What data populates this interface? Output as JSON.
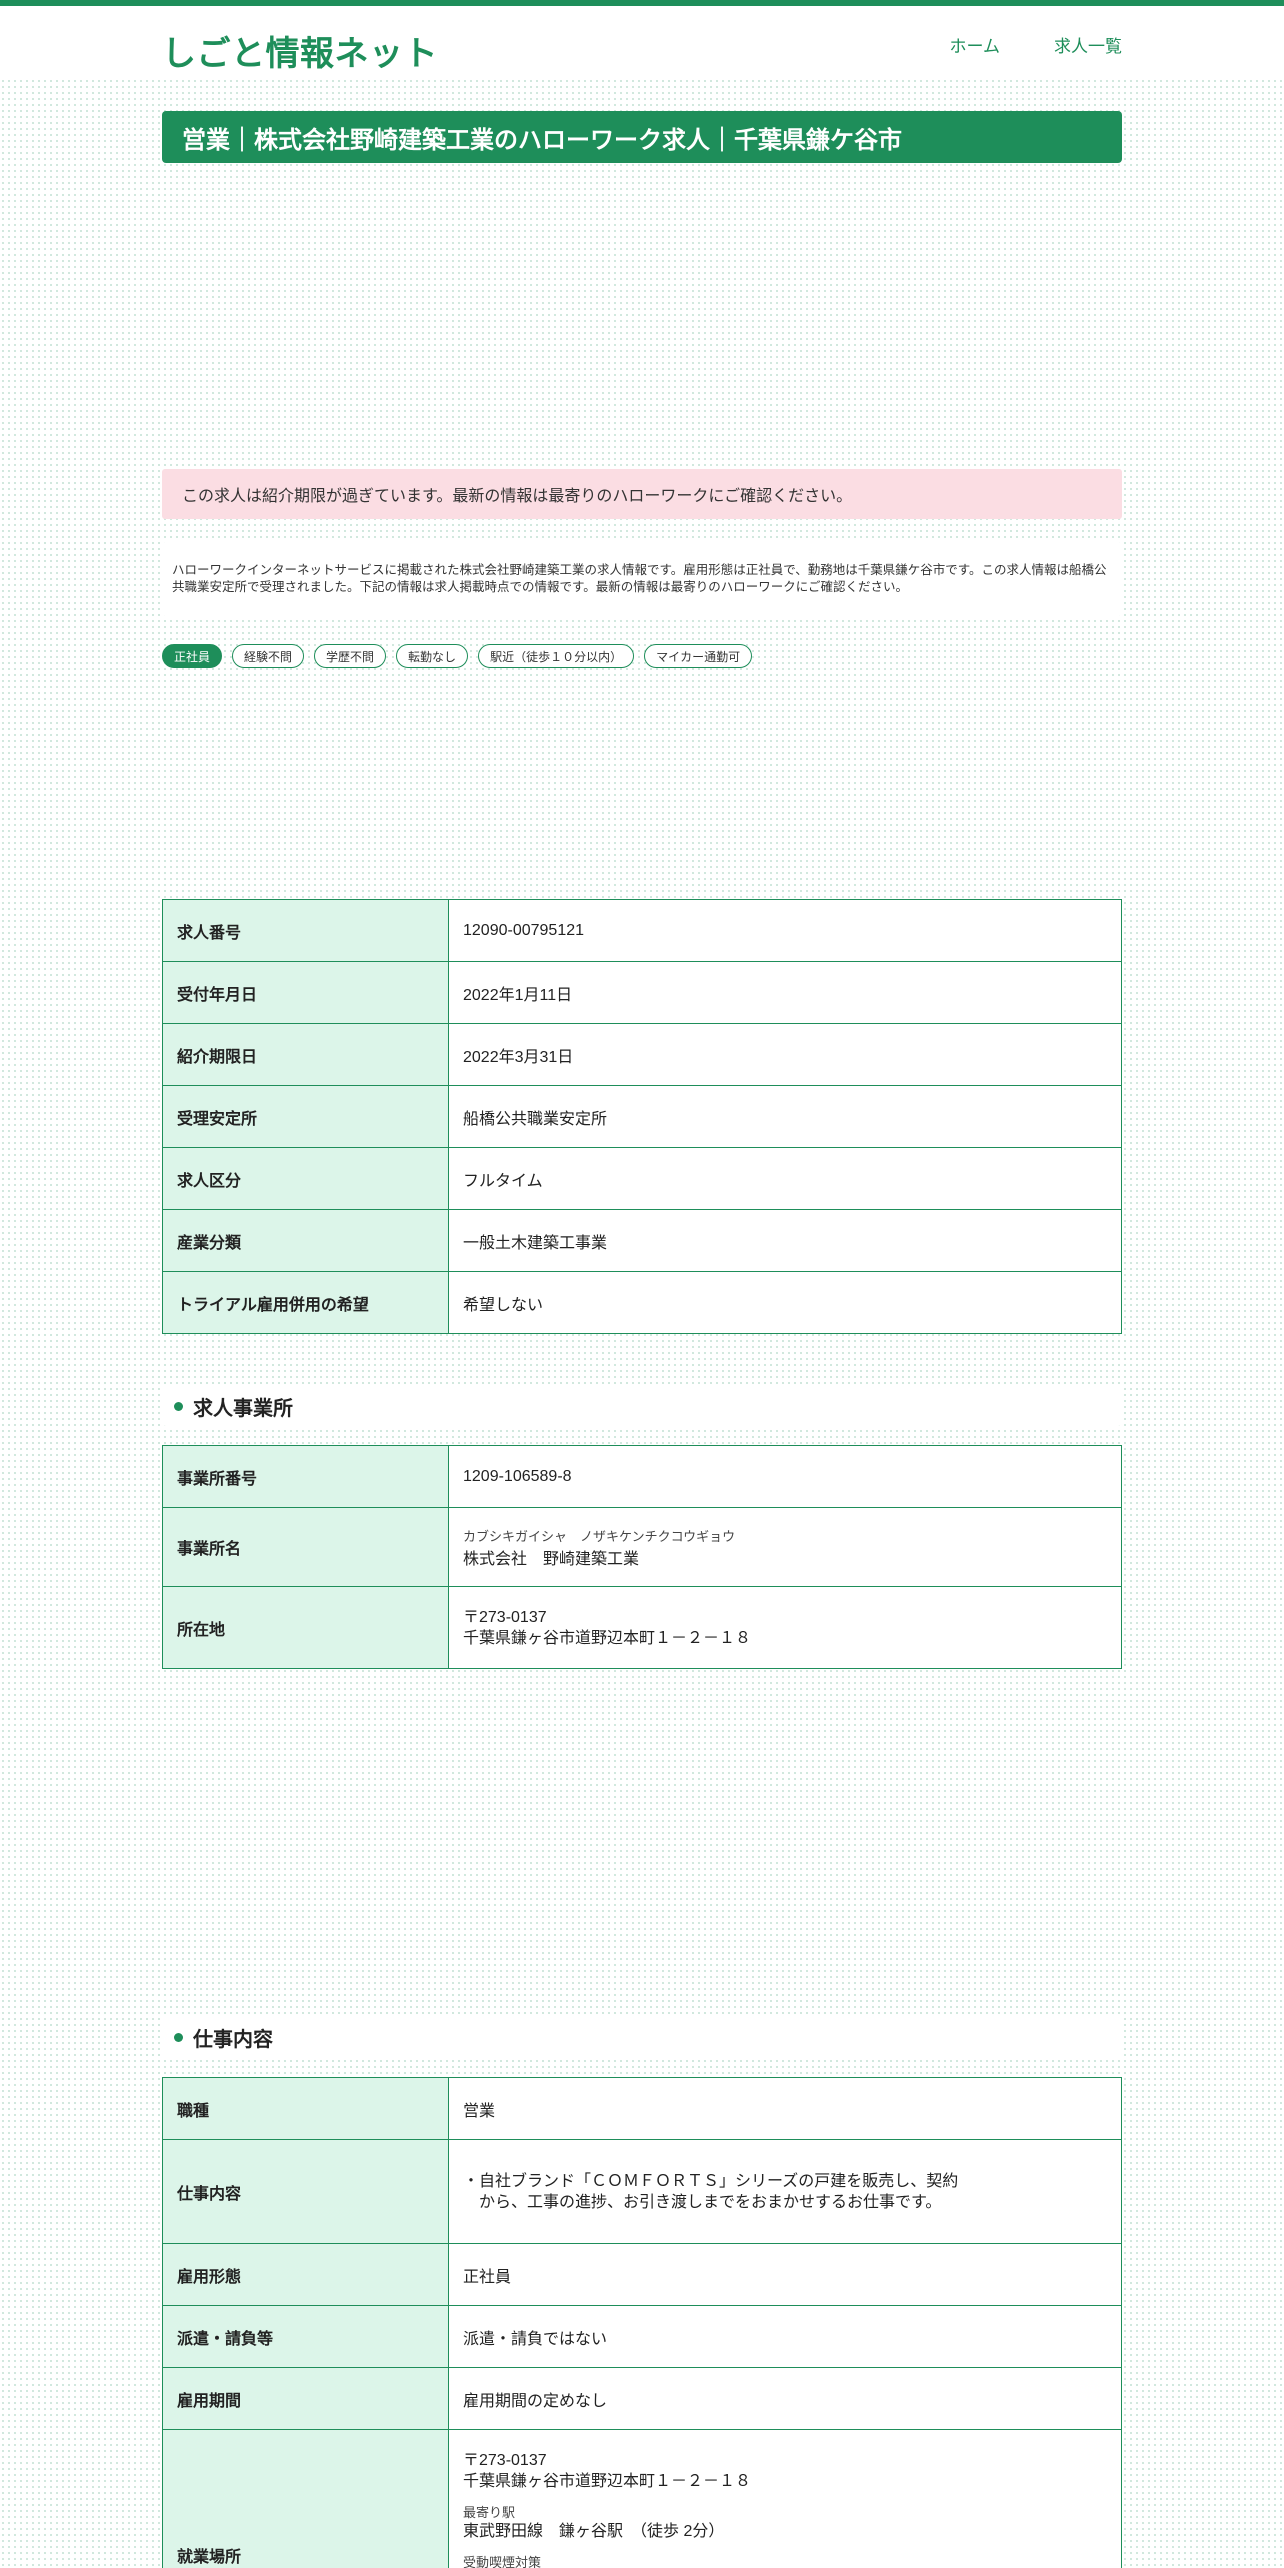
{
  "site": {
    "logo": "しごと情報ネット",
    "nav": [
      "ホーム",
      "求人一覧"
    ]
  },
  "page_title": "営業｜株式会社野崎建築工業のハローワーク求人｜千葉県鎌ケ谷市",
  "notice": "この求人は紹介期限が過ぎています。最新の情報は最寄りのハローワークにご確認ください。",
  "intro": "ハローワークインターネットサービスに掲載された株式会社野崎建築工業の求人情報です。雇用形態は正社員で、勤務地は千葉県鎌ケ谷市です。この求人情報は船橋公共職業安定所で受理されました。下記の情報は求人掲載時点での情報です。最新の情報は最寄りのハローワークにご確認ください。",
  "tags": [
    "正社員",
    "経験不問",
    "学歴不問",
    "転勤なし",
    "駅近（徒歩１０分以内）",
    "マイカー通勤可"
  ],
  "basic_info": [
    {
      "label": "求人番号",
      "value": "12090-00795121"
    },
    {
      "label": "受付年月日",
      "value": "2022年1月11日"
    },
    {
      "label": "紹介期限日",
      "value": "2022年3月31日"
    },
    {
      "label": "受理安定所",
      "value": "船橋公共職業安定所"
    },
    {
      "label": "求人区分",
      "value": "フルタイム"
    },
    {
      "label": "産業分類",
      "value": "一般土木建築工事業"
    },
    {
      "label": "トライアル雇用併用の希望",
      "value": "希望しない"
    }
  ],
  "company_section": {
    "heading": "求人事業所",
    "office_number_label": "事業所番号",
    "office_number": "1209-106589-8",
    "name_label": "事業所名",
    "name_kana": "カブシキガイシャ　ノザキケンチクコウギョウ",
    "name": "株式会社　野崎建築工業",
    "address_label": "所在地",
    "postal": "〒273-0137",
    "address": "千葉県鎌ヶ谷市道野辺本町１－２－１８"
  },
  "job_section": {
    "heading": "仕事内容",
    "type_label": "職種",
    "type": "営業",
    "content_label": "仕事内容",
    "content": "・自社ブランド「ＣＯＭＦＯＲＴＳ」シリーズの戸建を販売し、契約から、工事の進捗、お引き渡しまでをおまかせするお仕事です。",
    "employment_label": "雇用形態",
    "employment": "正社員",
    "dispatch_label": "派遣・請負等",
    "dispatch": "派遣・請負ではない",
    "period_label": "雇用期間",
    "period": "雇用期間の定めなし",
    "workplace_label": "就業場所",
    "workplace_postal": "〒273-0137",
    "workplace_address": "千葉県鎌ヶ谷市道野辺本町１－２－１８",
    "nearest_station_label": "最寄り駅",
    "nearest_station": "東武野田線　鎌ヶ谷駅　（徒歩 2分）",
    "smoking_label": "受動喫煙対策"
  }
}
